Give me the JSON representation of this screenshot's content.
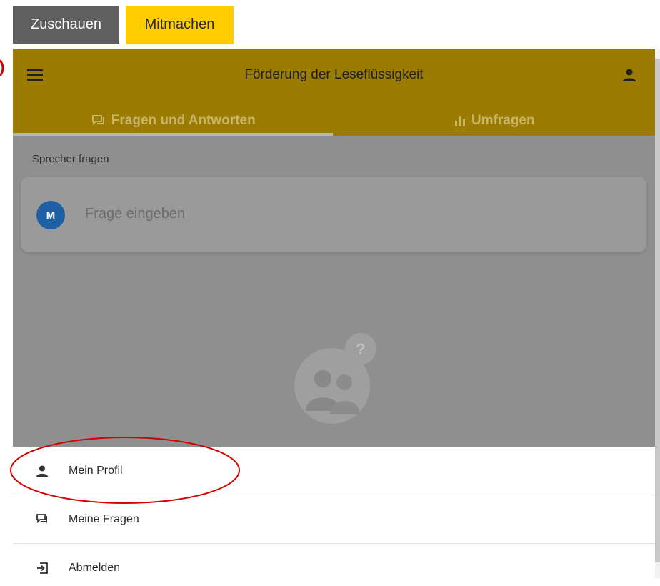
{
  "top_buttons": {
    "watch_label": "Zuschauen",
    "join_label": "Mitmachen"
  },
  "appbar": {
    "title": "Förderung der Leseflüssigkeit",
    "menu_icon": "menu-icon",
    "profile_icon": "person-icon"
  },
  "tabs": [
    {
      "label": "Fragen und Antworten",
      "icon": "chat-icon",
      "selected": true
    },
    {
      "label": "Umfragen",
      "icon": "bar-chart-icon",
      "selected": false
    }
  ],
  "ask": {
    "section_label": "Sprecher fragen",
    "avatar_initial": "M",
    "placeholder": "Frage eingeben"
  },
  "menu_items": [
    {
      "label": "Mein Profil",
      "icon": "person-icon"
    },
    {
      "label": "Meine Fragen",
      "icon": "chat-icon"
    },
    {
      "label": "Abmelden",
      "icon": "logout-icon"
    }
  ],
  "colors": {
    "brand": "#9b7c00",
    "join_button": "#ffcc00",
    "watch_button": "#5f5f5f",
    "avatar": "#1f5fa3",
    "annotation": "#d40000"
  }
}
